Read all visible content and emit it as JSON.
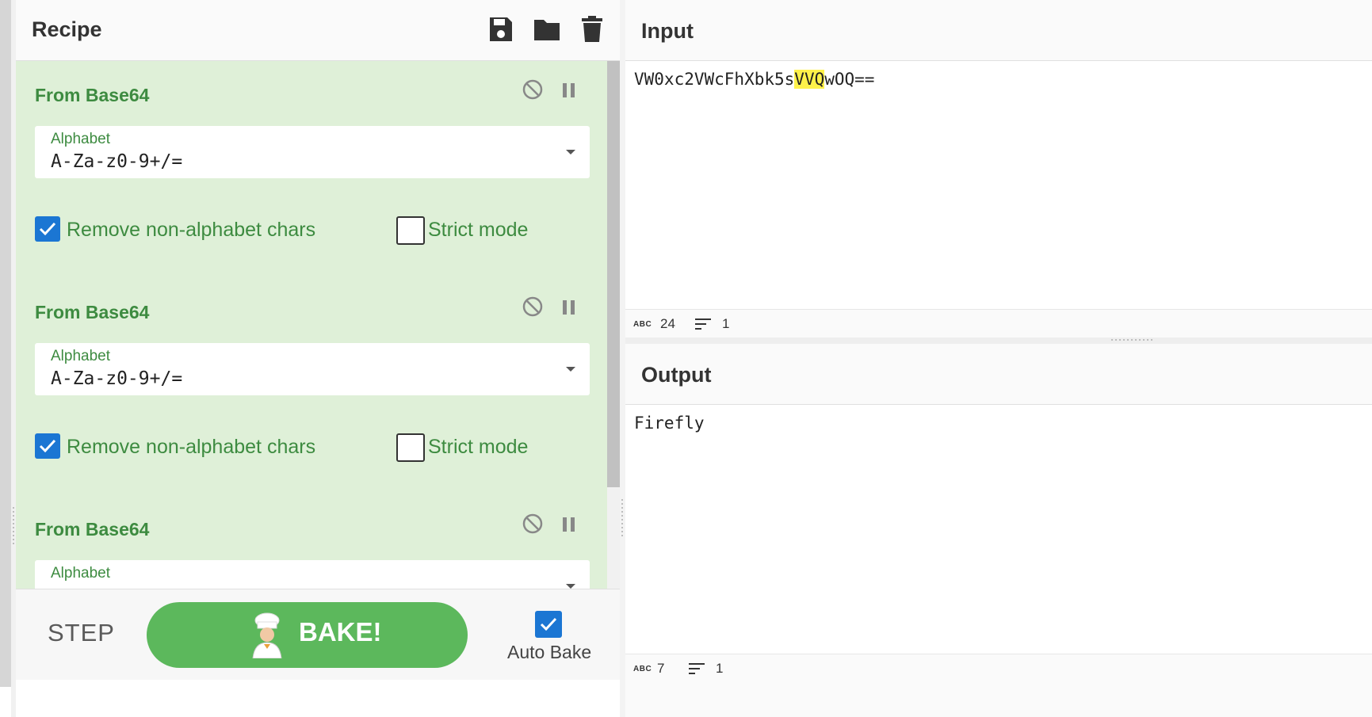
{
  "recipe": {
    "title": "Recipe",
    "icons": [
      "save-icon",
      "folder-icon",
      "trash-icon"
    ],
    "operations": [
      {
        "name": "From Base64",
        "alphabet_label": "Alphabet",
        "alphabet_value": "A-Za-z0-9+/=",
        "remove_label": "Remove non-alphabet chars",
        "remove_checked": true,
        "strict_label": "Strict mode",
        "strict_checked": false
      },
      {
        "name": "From Base64",
        "alphabet_label": "Alphabet",
        "alphabet_value": "A-Za-z0-9+/=",
        "remove_label": "Remove non-alphabet chars",
        "remove_checked": true,
        "strict_label": "Strict mode",
        "strict_checked": false
      },
      {
        "name": "From Base64",
        "alphabet_label": "Alphabet"
      }
    ]
  },
  "controls": {
    "step_label": "STEP",
    "bake_label": "BAKE!",
    "autobake_label": "Auto Bake",
    "autobake_checked": true
  },
  "input": {
    "title": "Input",
    "text_before": "VW0xc2VWcFhXbk5s",
    "text_highlight": "VVQ",
    "text_after": "wOQ==",
    "status_abc": "ABC",
    "char_count": "24",
    "line_count": "1"
  },
  "output": {
    "title": "Output",
    "text": "Firefly",
    "status_abc": "ABC",
    "char_count": "7",
    "line_count": "1"
  },
  "colors": {
    "accent_green": "#5cb85c",
    "op_bg": "#dff0d8",
    "op_text": "#3d8b40",
    "checkbox_blue": "#1b76d3",
    "highlight_yellow": "#fff24a"
  }
}
